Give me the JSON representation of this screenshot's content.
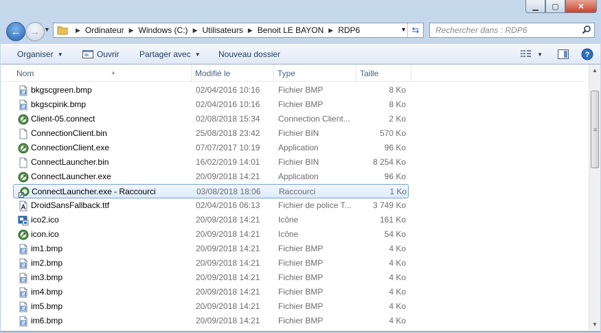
{
  "window": {
    "min_label": "▁",
    "max_label": "▢",
    "close_label": "✕"
  },
  "address": {
    "crumbs": [
      "Ordinateur",
      "Windows (C:)",
      "Utilisateurs",
      "Benoit LE BAYON",
      "RDP6"
    ]
  },
  "search": {
    "placeholder": "Rechercher dans : RDP6"
  },
  "toolbar": {
    "organize": "Organiser",
    "open": "Ouvrir",
    "share": "Partager avec",
    "new_folder": "Nouveau dossier"
  },
  "columns": {
    "name": "Nom",
    "modified": "Modifié le",
    "type": "Type",
    "size": "Taille"
  },
  "files": [
    {
      "name": "bkgscgreen.bmp",
      "date": "02/04/2016 10:16",
      "type": "Fichier BMP",
      "size": "8 Ko",
      "icon": "bmp-file-icon"
    },
    {
      "name": "bkgscpink.bmp",
      "date": "02/04/2016 10:16",
      "type": "Fichier BMP",
      "size": "8 Ko",
      "icon": "bmp-file-icon"
    },
    {
      "name": "Client-05.connect",
      "date": "02/08/2018 15:34",
      "type": "Connection Client...",
      "size": "2 Ko",
      "icon": "connect-app-icon"
    },
    {
      "name": "ConnectionClient.bin",
      "date": "25/08/2018 23:42",
      "type": "Fichier BIN",
      "size": "570 Ko",
      "icon": "blank-file-icon"
    },
    {
      "name": "ConnectionClient.exe",
      "date": "07/07/2017 10:19",
      "type": "Application",
      "size": "96 Ko",
      "icon": "connect-app-icon"
    },
    {
      "name": "ConnectLauncher.bin",
      "date": "16/02/2019 14:01",
      "type": "Fichier BIN",
      "size": "8 254 Ko",
      "icon": "blank-file-icon"
    },
    {
      "name": "ConnectLauncher.exe",
      "date": "20/09/2018 14:21",
      "type": "Application",
      "size": "96 Ko",
      "icon": "connect-app-icon"
    },
    {
      "name": "ConnectLauncher.exe - Raccourci",
      "date": "03/08/2018 18:06",
      "type": "Raccourci",
      "size": "1 Ko",
      "icon": "shortcut-icon",
      "selected": true
    },
    {
      "name": "DroidSansFallback.ttf",
      "date": "02/04/2016 06:13",
      "type": "Fichier de police T...",
      "size": "3 749 Ko",
      "icon": "font-file-icon"
    },
    {
      "name": "ico2.ico",
      "date": "20/09/2018 14:21",
      "type": "Icône",
      "size": "161 Ko",
      "icon": "ico-image-icon"
    },
    {
      "name": "icon.ico",
      "date": "20/09/2018 14:21",
      "type": "Icône",
      "size": "54 Ko",
      "icon": "connect-app-icon"
    },
    {
      "name": "im1.bmp",
      "date": "20/09/2018 14:21",
      "type": "Fichier BMP",
      "size": "4 Ko",
      "icon": "bmp-file-icon"
    },
    {
      "name": "im2.bmp",
      "date": "20/09/2018 14:21",
      "type": "Fichier BMP",
      "size": "4 Ko",
      "icon": "bmp-file-icon"
    },
    {
      "name": "im3.bmp",
      "date": "20/09/2018 14:21",
      "type": "Fichier BMP",
      "size": "4 Ko",
      "icon": "bmp-file-icon"
    },
    {
      "name": "im4.bmp",
      "date": "20/09/2018 14:21",
      "type": "Fichier BMP",
      "size": "4 Ko",
      "icon": "bmp-file-icon"
    },
    {
      "name": "im5.bmp",
      "date": "20/09/2018 14:21",
      "type": "Fichier BMP",
      "size": "4 Ko",
      "icon": "bmp-file-icon"
    },
    {
      "name": "im6.bmp",
      "date": "20/09/2018 14:21",
      "type": "Fichier BMP",
      "size": "4 Ko",
      "icon": "bmp-file-icon"
    }
  ],
  "colors": {
    "selection_border": "#7da2ce",
    "selection_fill": "#dcebfc",
    "header_text": "#4c607a",
    "toolbar_text": "#1e395b"
  }
}
